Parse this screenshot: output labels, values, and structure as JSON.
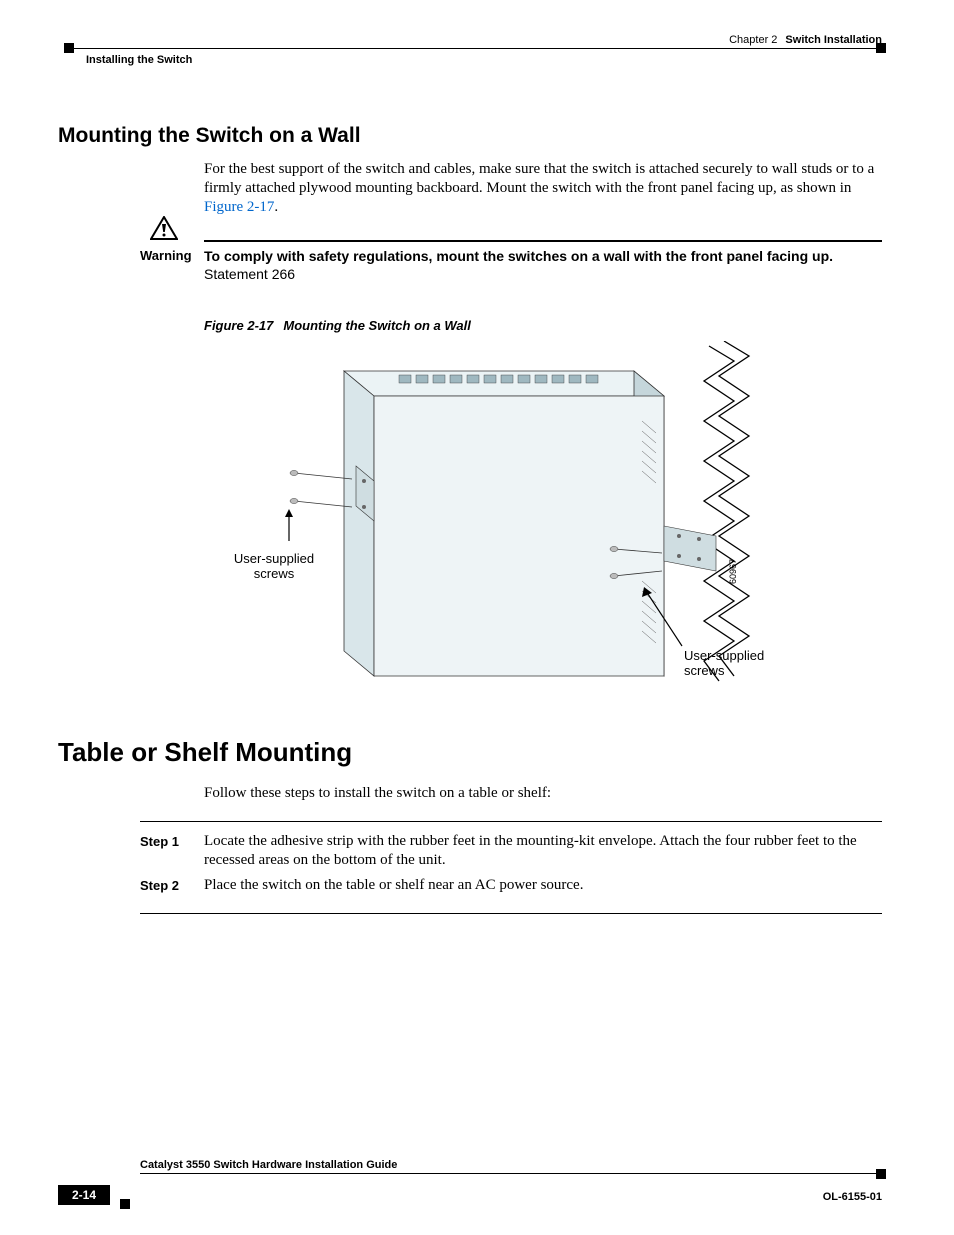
{
  "header": {
    "chapter_prefix": "Chapter 2",
    "chapter_title": "Switch Installation",
    "section": "Installing the Switch"
  },
  "section1": {
    "heading": "Mounting the Switch on a Wall",
    "body_part1": "For the best support of the switch and cables, make sure that the switch is attached securely to wall studs or to a firmly attached plywood mounting backboard. Mount the switch with the front panel facing up, as shown in ",
    "figref": "Figure 2-17",
    "body_part2": "."
  },
  "warning": {
    "label": "Warning",
    "text": "To comply with safety regulations, mount the switches on a wall with the front panel facing up.",
    "statement": "Statement 266"
  },
  "figure": {
    "number": "Figure 2-17",
    "caption": "Mounting the Switch on a Wall",
    "label_left": "User-supplied screws",
    "label_right": "User-supplied screws",
    "id": "60967"
  },
  "section2": {
    "heading": "Table or Shelf Mounting",
    "intro": "Follow these steps to install the switch on a table or shelf:",
    "steps": [
      {
        "label": "Step 1",
        "text": "Locate the adhesive strip with the rubber feet in the mounting-kit envelope. Attach the four rubber feet to the recessed areas on the bottom of the unit."
      },
      {
        "label": "Step 2",
        "text": "Place the switch on the table or shelf near an AC power source."
      }
    ]
  },
  "footer": {
    "guide_title": "Catalyst 3550 Switch Hardware Installation Guide",
    "page_num": "2-14",
    "doc_id": "OL-6155-01"
  }
}
